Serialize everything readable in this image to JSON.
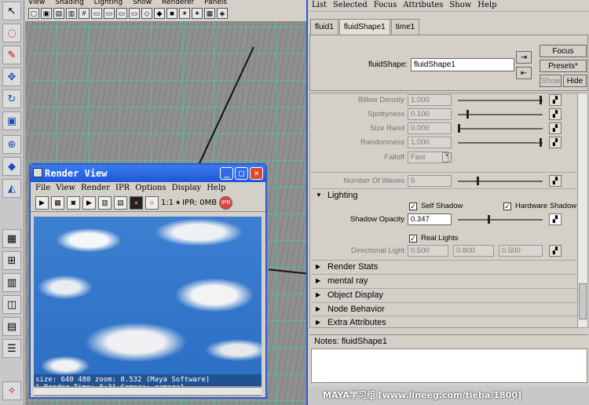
{
  "viewport": {
    "menu": [
      "View",
      "Shading",
      "Lighting",
      "Show",
      "Renderer",
      "Panels"
    ]
  },
  "render_view": {
    "title": "Render View",
    "menu": [
      "File",
      "View",
      "Render",
      "IPR",
      "Options",
      "Display",
      "Help"
    ],
    "ratio": "1:1",
    "ipr_status": "IPR: 0MB",
    "status_line1": "size: 640 480 zoom: 0.532      (Maya Software)",
    "status_line2": "1       Render Time: 0:31      Camera: camera1"
  },
  "attribute_editor": {
    "menu": [
      "List",
      "Selected",
      "Focus",
      "Attributes",
      "Show",
      "Help"
    ],
    "tabs": [
      "fluid1",
      "fluidShape1",
      "time1"
    ],
    "active_tab": "fluidShape1",
    "shape_label": "fluidShape:",
    "shape_value": "fluidShape1",
    "buttons": {
      "focus": "Focus",
      "presets": "Presets*",
      "show": "Show",
      "hide": "Hide"
    },
    "attrs": {
      "billow_density": {
        "label": "Billow Density",
        "value": "1.000"
      },
      "spottyness": {
        "label": "Spottyness",
        "value": "0.100"
      },
      "size_rand": {
        "label": "Size Rand",
        "value": "0.000"
      },
      "randomness": {
        "label": "Randomness",
        "value": "1.000"
      },
      "falloff": {
        "label": "Falloff",
        "value": "Fast"
      },
      "num_waves": {
        "label": "Number Of Waves",
        "value": "5"
      }
    },
    "lighting": {
      "section": "Lighting",
      "self_shadow": "Self Shadow",
      "hardware_shadow": "Hardware Shadow",
      "shadow_opacity_label": "Shadow Opacity",
      "shadow_opacity": "0.347",
      "real_lights": "Real Lights",
      "directional_light_label": "Directional Light",
      "dir_x": "0.500",
      "dir_y": "0.800",
      "dir_z": "0.500"
    },
    "sections": [
      "Render Stats",
      "mental ray",
      "Object Display",
      "Node Behavior",
      "Extra Attributes"
    ],
    "notes_label": "Notes:  fluidShape1",
    "watermark": "MAYA学习组  [www.lineeg.com/tieba/1800]"
  }
}
